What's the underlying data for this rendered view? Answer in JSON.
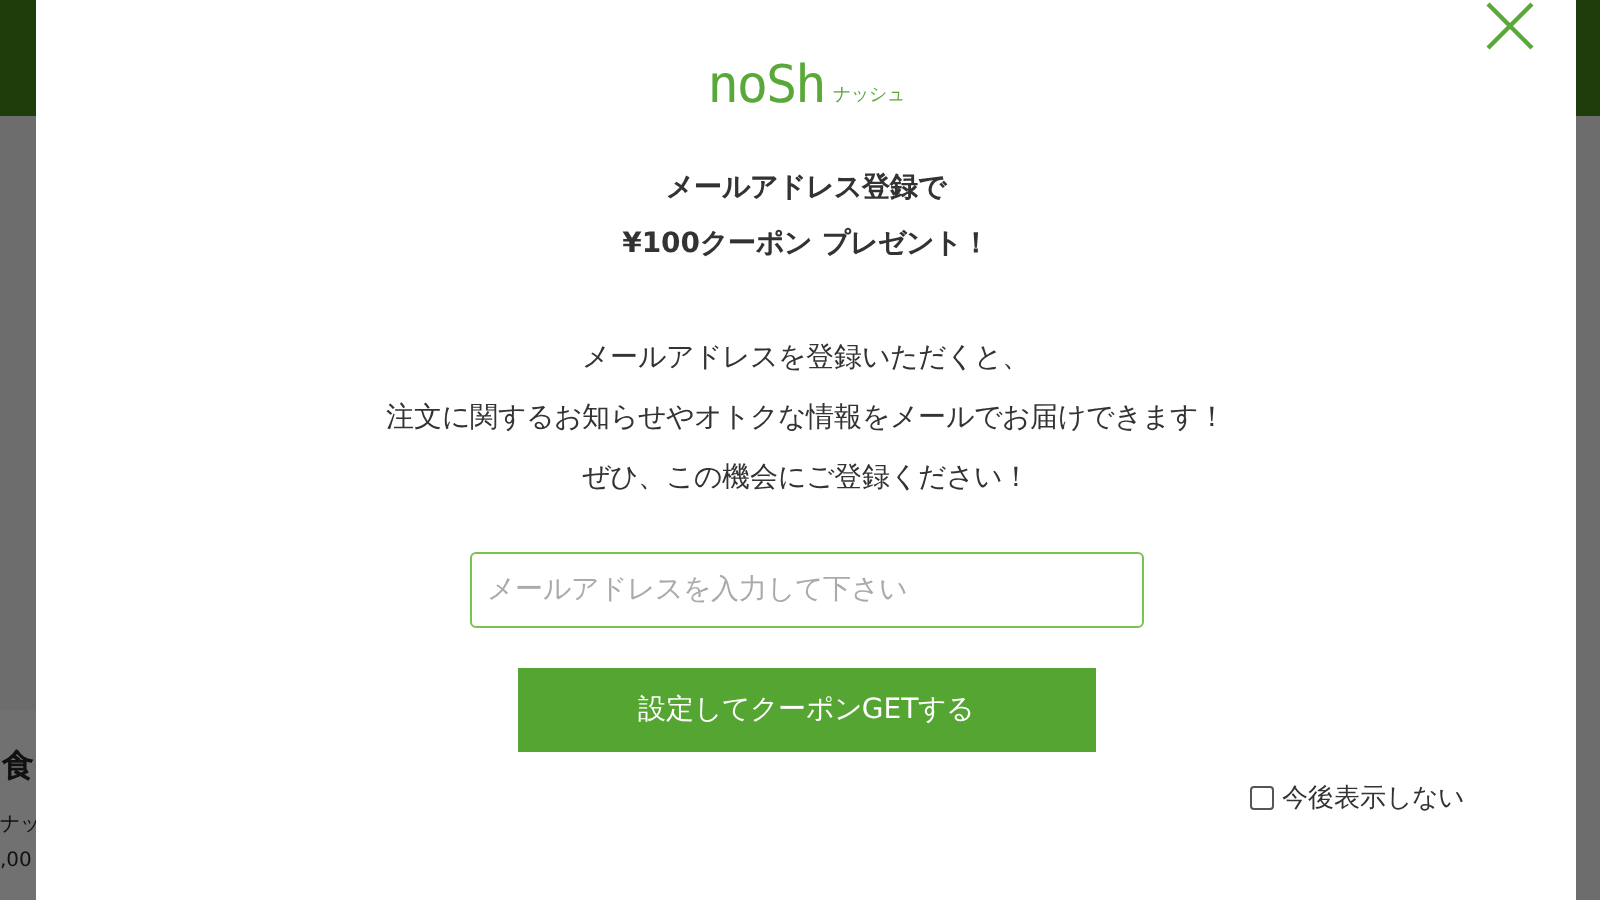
{
  "background": {
    "fragments": [
      "食",
      "ナッ",
      ",00"
    ]
  },
  "modal": {
    "logo": {
      "wordmark": "noSh",
      "kana": "ナッシュ"
    },
    "heading": [
      "メールアドレス登録で",
      "¥100クーポン プレゼント！"
    ],
    "message": [
      "メールアドレスを登録いただくと、",
      "注文に関するお知らせやオトクな情報をメールでお届けできます！",
      "ぜひ、この機会にご登録ください！"
    ],
    "email": {
      "placeholder": "メールアドレスを入力して下さい"
    },
    "submit": "設定してクーポンGETする",
    "dont_show": {
      "label": "今後表示しない",
      "checked": false
    }
  }
}
